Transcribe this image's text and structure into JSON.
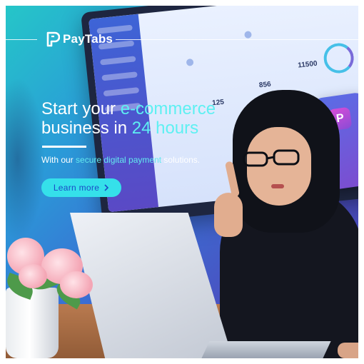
{
  "brand": {
    "name": "PayTabs",
    "colors": {
      "accent": "#5ef0f2",
      "button_bg": "#35e0ea",
      "button_text": "#1b4ac7",
      "text": "#ffffff"
    }
  },
  "headline": {
    "line1_plain": "Start your ",
    "line1_accent": "e-commerce",
    "line2_plain": "business in ",
    "line2_accent": "24 hours"
  },
  "subheadline": {
    "before": "With our ",
    "accent": "secure digital payment",
    "after": " solutions."
  },
  "cta": {
    "label": "Learn more",
    "icon": "chevron-right-icon"
  },
  "dashboard": {
    "stats": [
      "125",
      "856",
      "11500"
    ]
  }
}
